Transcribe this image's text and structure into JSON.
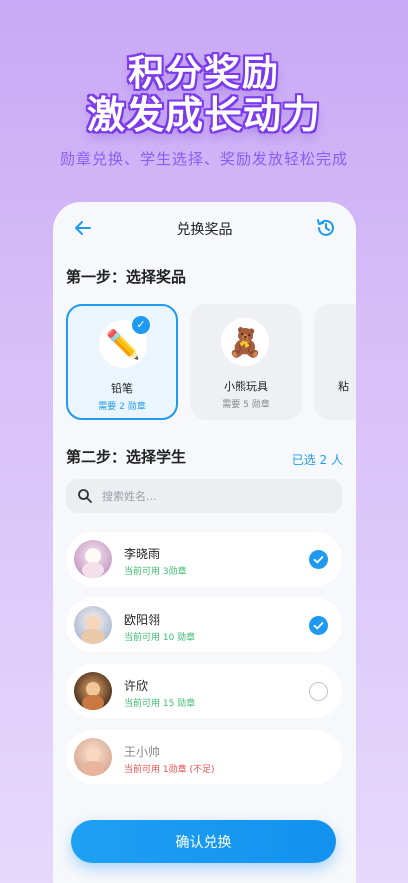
{
  "hero": {
    "line1": "积分奖励",
    "line2": "激发成长动力",
    "subtitle": "勋章兑换、学生选择、奖励发放轻松完成"
  },
  "topbar": {
    "title": "兑换奖品",
    "back_icon": "arrow-left-icon",
    "history_icon": "history-icon"
  },
  "step1": {
    "title": "第一步：选择奖品"
  },
  "prizes": [
    {
      "name": "铅笔",
      "cost": "需要 2 勋章",
      "icon": "✏️",
      "selected": true
    },
    {
      "name": "小熊玩具",
      "cost": "需要 5 勋章",
      "icon": "🧸",
      "selected": false
    },
    {
      "name": "粘",
      "cost": "",
      "icon": "",
      "selected": false
    }
  ],
  "step2": {
    "title": "第二步：选择学生",
    "selected_count": "已选 2 人"
  },
  "search": {
    "placeholder": "搜索姓名..."
  },
  "students": [
    {
      "name": "李晓雨",
      "points": "当前可用 3勋章",
      "checked": true,
      "insufficient": false
    },
    {
      "name": "欧阳翎",
      "points": "当前可用 10 勋章",
      "checked": true,
      "insufficient": false
    },
    {
      "name": "许欣",
      "points": "当前可用 15 勋章",
      "checked": false,
      "insufficient": false
    },
    {
      "name": "王小帅",
      "points": "当前可用 1勋章 (不足)",
      "checked": null,
      "insufficient": true
    }
  ],
  "confirm": {
    "label": "确认兑换"
  },
  "colors": {
    "accent": "#1e9bf0",
    "available": "#3bbf6e",
    "insufficient": "#f05050",
    "hero_outline": "#7c3aed"
  }
}
